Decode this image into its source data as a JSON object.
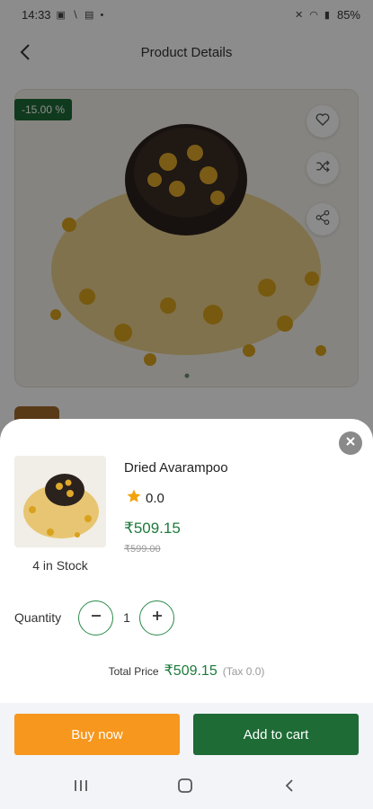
{
  "status_bar": {
    "time": "14:33",
    "battery": "85%"
  },
  "header": {
    "title": "Product Details"
  },
  "product": {
    "discount_badge": "-15.00 %",
    "name": "Dried Avarampoo",
    "rating": "0.0",
    "price_current": "₹509.15",
    "price_old": "₹599.00",
    "stock": "4 in Stock"
  },
  "quantity": {
    "label": "Quantity",
    "value": "1",
    "minus_symbol": "−",
    "plus_symbol": "+"
  },
  "total": {
    "label": "Total Price",
    "value": "₹509.15",
    "tax": "(Tax 0.0)"
  },
  "actions": {
    "buy_now": "Buy now",
    "add_to_cart": "Add to cart"
  },
  "colors": {
    "accent_green": "#1e6b36",
    "price_green": "#1e7a3c",
    "buy_orange": "#f7971e"
  },
  "icons": [
    "back-icon",
    "heart-icon",
    "shuffle-icon",
    "share-icon",
    "close-icon",
    "star-icon",
    "minus-icon",
    "plus-icon",
    "recents-icon",
    "home-icon",
    "nav-back-icon"
  ]
}
